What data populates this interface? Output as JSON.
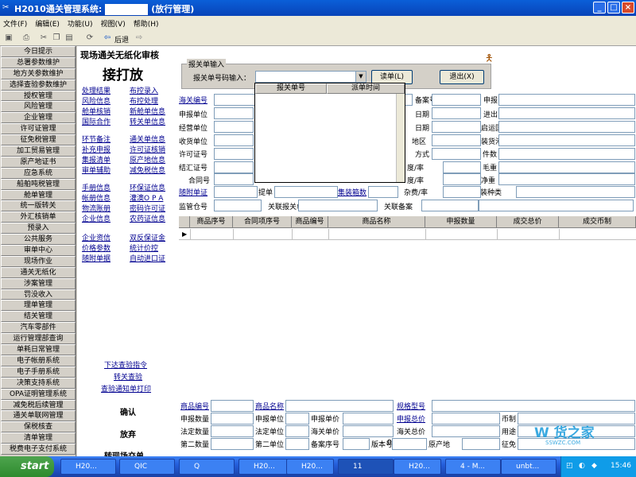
{
  "window": {
    "title": "H2010通关管理系统:",
    "title_suffix": "(放行管理)",
    "btn_min": "_",
    "btn_max": "□",
    "btn_close": "×"
  },
  "menu": [
    "文件(F)",
    "编辑(E)",
    "功能(U)",
    "视图(V)",
    "帮助(H)"
  ],
  "toolbar": {
    "back_label": "后退",
    "forward_label": "⇨"
  },
  "sidebar": [
    "今日提示",
    "总署参数维护",
    "地方关参数维护",
    "选择查验参数维护",
    "授权管理",
    "风险管理",
    "企业管理",
    "许可证管理",
    "征免税管理",
    "加工贸易管理",
    "原产地证书",
    "应急系统",
    "船舶吨税管理",
    "舱单管理",
    "统一版转关",
    "外汇核销单",
    "预录入",
    "公共服务",
    "审单中心",
    "现场作业",
    "通关无纸化",
    "涉案管理",
    "罚没收入",
    "理单管理",
    "结关管理",
    "汽车零部件",
    "运行管理部查询",
    "单耗日常管理",
    "电子帐册系统",
    "电子手册系统",
    "决策支持系统",
    "OPA证明管理系统",
    "减免税后续管理",
    "通关单联网管理",
    "保税核查",
    "清单管理",
    "税费电子支付系统"
  ],
  "left_panel": {
    "title": "现场通关无纸化审核",
    "subtitle": "接打放",
    "links": [
      "处理结果",
      "布控录入",
      "风险信息",
      "布控处理",
      "舱单核销",
      "新舱单信息",
      "国际合作",
      "转关单信息",
      "环节备注",
      "通关单信息",
      "补充申报",
      "许可证核销",
      "集报清单",
      "原产地信息",
      "审单辅助",
      "减免税信息",
      "手册信息",
      "环保证信息",
      "帐册信息",
      "灌澳O P A",
      "物流账册",
      "密码许可证",
      "企业信息",
      "农药证信息",
      "企业资信",
      "双反保证金",
      "价格参数",
      "统计价控",
      "随附单据",
      "自动进口证"
    ],
    "bottom_links": [
      "下达查验指令",
      "转关查验",
      "查验通知单打印"
    ],
    "actions": [
      "确认",
      "放弃",
      "转现场交单"
    ]
  },
  "form": {
    "group_label": "报关单输入",
    "input_label": "报关单号码输入：",
    "read_button": "读单(L)",
    "exit_button": "退出(X)",
    "dropdown_headers": [
      "报关单号",
      "派单时间"
    ],
    "labels": [
      "海关编号",
      "申报单位",
      "经营单位",
      "收货单位",
      "许可证号",
      "结汇证号",
      "合同号",
      "随附单证",
      "监管仓号",
      "提单",
      "集装箱数",
      "关联报关单",
      "关联备案",
      "备注",
      "备案号",
      "日期",
      "日期",
      "地区",
      "方式",
      "度/率",
      "度/率",
      "杂费/率",
      "申报口岸",
      "进出口岸",
      "启运国",
      "装货港",
      "件数",
      "毛重",
      "净重",
      "包装种类",
      "空",
      "空"
    ]
  },
  "grid": {
    "headers": [
      "商品序号",
      "合同项序号",
      "商品编号",
      "商品名称",
      "申报数量",
      "成交总价",
      "成交币制"
    ]
  },
  "bottom_form": {
    "labels": [
      "商品编号",
      "商品名称",
      "规格型号",
      "申报数量",
      "申报单位",
      "申报单价",
      "申报总价",
      "币制",
      "法定数量",
      "法定单位",
      "海关单价",
      "海关总价",
      "用途",
      "第二数量",
      "第二单位",
      "备案序号",
      "版本号",
      "原产地",
      "征免"
    ],
    "value_zero": "0"
  },
  "taskbar": {
    "start": "start",
    "tasks": [
      "H20...",
      "QIC",
      "Q",
      "H20...",
      "H20...",
      "11",
      "H20...",
      "4 - M...",
      "unbt..."
    ],
    "time": "15:46"
  },
  "watermark": {
    "text": "货之家",
    "sub": "SSWZC.COM"
  }
}
